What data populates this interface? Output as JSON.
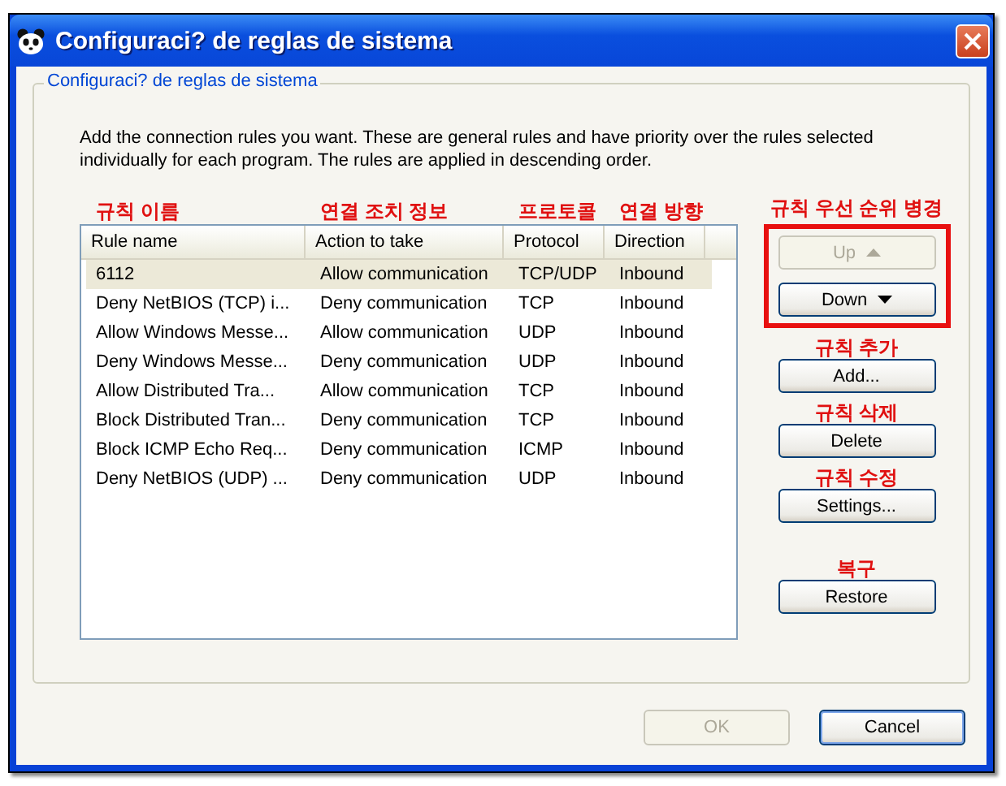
{
  "window": {
    "title": "Configuraci? de reglas de sistema"
  },
  "group": {
    "title": "Configuraci? de reglas de sistema"
  },
  "description": "Add the connection rules you want. These are general rules and have priority over the rules selected individually for each program. The rules are applied in descending order.",
  "column_notes": [
    "규칙 이름",
    "연결 조치 정보",
    "프로토콜",
    "연결 방향"
  ],
  "table": {
    "columns": [
      "Rule name",
      "Action to take",
      "Protocol",
      "Direction"
    ],
    "rows": [
      {
        "cells": [
          "6112",
          "Allow communication",
          "TCP/UDP",
          "Inbound"
        ],
        "selected": true
      },
      {
        "cells": [
          "Deny NetBIOS (TCP) i...",
          "Deny communication",
          "TCP",
          "Inbound"
        ],
        "selected": false
      },
      {
        "cells": [
          "Allow Windows Messe...",
          "Allow communication",
          "UDP",
          "Inbound"
        ],
        "selected": false
      },
      {
        "cells": [
          "Deny Windows Messe...",
          "Deny communication",
          "UDP",
          "Inbound"
        ],
        "selected": false
      },
      {
        "cells": [
          "Allow Distributed Tra...",
          "Allow communication",
          "TCP",
          "Inbound"
        ],
        "selected": false
      },
      {
        "cells": [
          "Block Distributed Tran...",
          "Deny communication",
          "TCP",
          "Inbound"
        ],
        "selected": false
      },
      {
        "cells": [
          "Block ICMP Echo Req...",
          "Deny communication",
          "ICMP",
          "Inbound"
        ],
        "selected": false
      },
      {
        "cells": [
          "Deny NetBIOS (UDP) ...",
          "Deny communication",
          "UDP",
          "Inbound"
        ],
        "selected": false
      }
    ]
  },
  "order_note": "규칙 우선 순위 병경",
  "order_buttons": [
    {
      "label": "Up",
      "kind": "up",
      "disabled": true
    },
    {
      "label": "Down",
      "kind": "down",
      "disabled": false
    }
  ],
  "rule_buttons": [
    {
      "note": "규칙 추가",
      "label": "Add...",
      "disabled": false
    },
    {
      "note": "규칙 삭제",
      "label": "Delete",
      "disabled": false
    },
    {
      "note": "규칙 수정",
      "label": "Settings...",
      "disabled": false
    },
    {
      "note": "복구",
      "label": "Restore",
      "disabled": false
    }
  ],
  "footer_buttons": [
    {
      "label": "OK",
      "disabled": true,
      "default": false
    },
    {
      "label": "Cancel",
      "disabled": false,
      "default": true
    }
  ]
}
